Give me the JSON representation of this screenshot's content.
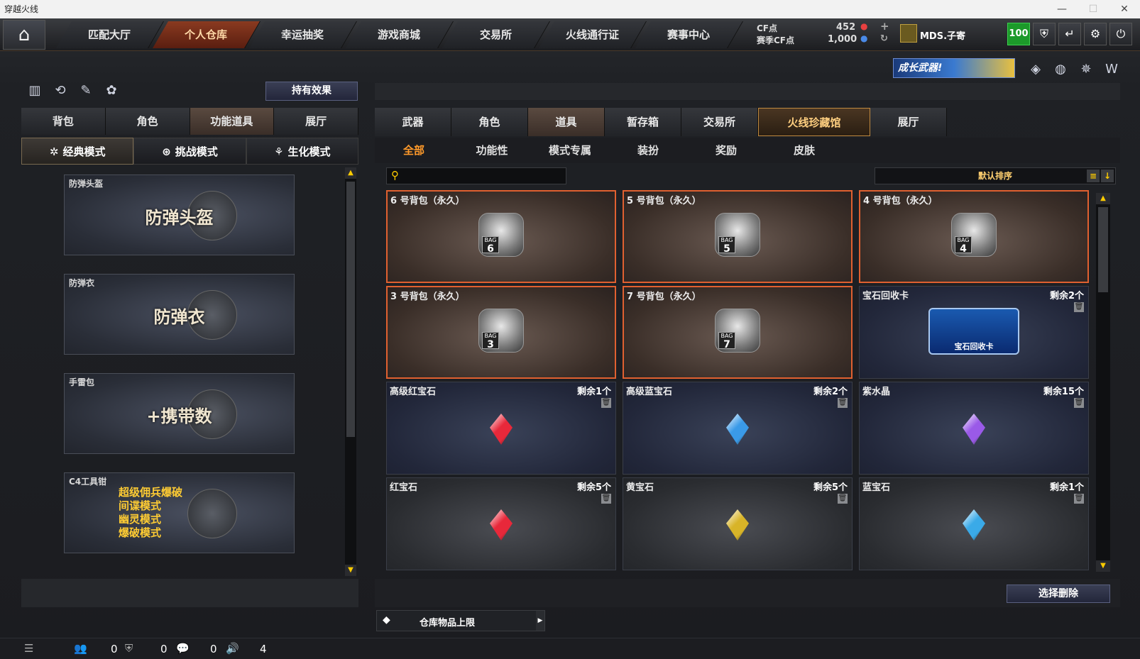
{
  "window": {
    "title": "穿越火线"
  },
  "nav": {
    "tabs": [
      "匹配大厅",
      "个人仓库",
      "幸运抽奖",
      "游戏商城",
      "交易所",
      "火线通行证",
      "赛事中心"
    ],
    "active": "个人仓库",
    "cf_label": "CF点",
    "cf_value": "452",
    "season_cf_label": "赛季CF点",
    "season_cf_value": "1,000",
    "user_name": "MDS.子寄",
    "level": "100"
  },
  "left": {
    "effect_button": "持有效果",
    "tabs": [
      "背包",
      "角色",
      "功能道具",
      "展厅"
    ],
    "active_tab": "功能道具",
    "modes": [
      "经典模式",
      "挑战模式",
      "生化模式"
    ],
    "active_mode": "经典模式",
    "cards": [
      {
        "title": "防弹头盔",
        "banner": "防弹头盔"
      },
      {
        "title": "防弹衣",
        "banner": "防弹衣"
      },
      {
        "title": "手雷包",
        "banner": "+携带数"
      },
      {
        "title": "C4工具钳",
        "lines": [
          "超级佣兵爆破",
          "间谍模式",
          "幽灵模式",
          "爆破模式"
        ]
      }
    ]
  },
  "right": {
    "promo": "成长武器!",
    "tabs": [
      "武器",
      "角色",
      "道具",
      "暂存箱",
      "交易所",
      "火线珍藏馆",
      "展厅"
    ],
    "active_tab": "道具",
    "sub_tabs": [
      "全部",
      "功能性",
      "模式专属",
      "装扮",
      "奖励",
      "皮肤"
    ],
    "active_sub_tab": "全部",
    "search": {
      "placeholder": ""
    },
    "sort": "默认排序",
    "items": [
      {
        "name": "6 号背包（永久）",
        "kind": "bag",
        "num": "6"
      },
      {
        "name": "5 号背包（永久）",
        "kind": "bag",
        "num": "5"
      },
      {
        "name": "4 号背包（永久）",
        "kind": "bag",
        "num": "4"
      },
      {
        "name": "3 号背包（永久）",
        "kind": "bag",
        "num": "3"
      },
      {
        "name": "7 号背包（永久）",
        "kind": "bag",
        "num": "7"
      },
      {
        "name": "宝石回收卡",
        "kind": "card",
        "count": "剩余2个",
        "card_text": "宝石回收卡"
      },
      {
        "name": "高级红宝石",
        "kind": "gem",
        "count": "剩余1个",
        "color": "#e8283a"
      },
      {
        "name": "高级蓝宝石",
        "kind": "gem",
        "count": "剩余2个",
        "color": "#3a9ae8"
      },
      {
        "name": "紫水晶",
        "kind": "gem",
        "count": "剩余15个",
        "color": "#9a5ae8"
      },
      {
        "name": "红宝石",
        "kind": "gem",
        "count": "剩余5个",
        "color": "#e8283a"
      },
      {
        "name": "黄宝石",
        "kind": "gem",
        "count": "剩余5个",
        "color": "#d8b428"
      },
      {
        "name": "蓝宝石",
        "kind": "gem",
        "count": "剩余1个",
        "color": "#3aaae8"
      }
    ],
    "delete_button": "选择删除",
    "capacity_label": "仓库物品上限"
  },
  "status": {
    "v1": "0",
    "v2": "0",
    "v3": "0",
    "v4": "4"
  },
  "bag_label": "BAG"
}
